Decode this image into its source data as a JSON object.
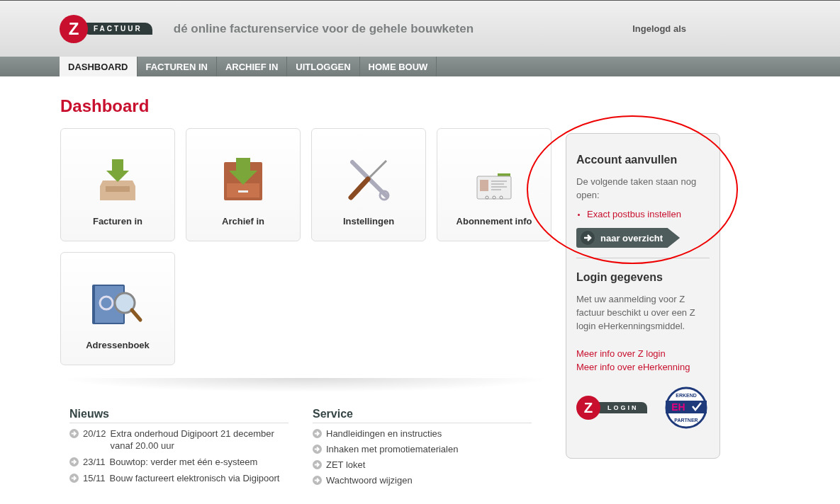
{
  "header": {
    "logo": {
      "letter": "Z",
      "word": "FACTUUR"
    },
    "tagline": "dé online facturenservice voor de gehele bouwketen",
    "user": "Ingelogd als"
  },
  "nav": [
    {
      "label": "DASHBOARD",
      "selected": true
    },
    {
      "label": "FACTUREN IN",
      "selected": false
    },
    {
      "label": "ARCHIEF IN",
      "selected": false
    },
    {
      "label": "UITLOGGEN",
      "selected": false
    },
    {
      "label": "HOME BOUW",
      "selected": false
    }
  ],
  "page_title": "Dashboard",
  "tiles": [
    {
      "label": "Facturen in",
      "kind": "inbox"
    },
    {
      "label": "Archief in",
      "kind": "cabinet"
    },
    {
      "label": "Instellingen",
      "kind": "tools"
    },
    {
      "label": "Abonnement info",
      "kind": "card"
    },
    {
      "label": "Adressenboek",
      "kind": "addressbook"
    }
  ],
  "sidebar": {
    "account": {
      "title": "Account aanvullen",
      "text": "De volgende taken staan nog open:",
      "tasks": [
        "Exact postbus instellen"
      ],
      "button": "naar overzicht"
    },
    "login": {
      "title": "Login gegevens",
      "text": "Met uw aanmelding voor Z factuur beschikt u over een Z login eHerkenningsmiddel.",
      "links": [
        "Meer info over Z login",
        "Meer info over eHerkenning"
      ],
      "zlogin": {
        "letter": "Z",
        "word": "LOGIN"
      },
      "badge": {
        "top": "ERKEND",
        "center": "EH",
        "bottom": "PARTNER"
      }
    }
  },
  "news": {
    "title": "Nieuws",
    "items": [
      {
        "date": "20/12",
        "text": "Extra onderhoud Digipoort 21 december vanaf 20.00 uur"
      },
      {
        "date": "23/11",
        "text": "Bouwtop: verder met één e-systeem"
      },
      {
        "date": "15/11",
        "text": "Bouw factureert elektronisch via Digipoort"
      }
    ]
  },
  "service": {
    "title": "Service",
    "items": [
      "Handleidingen en instructies",
      "Inhaken met promotiematerialen",
      "ZET loket",
      "Wachtwoord wijzigen"
    ]
  }
}
